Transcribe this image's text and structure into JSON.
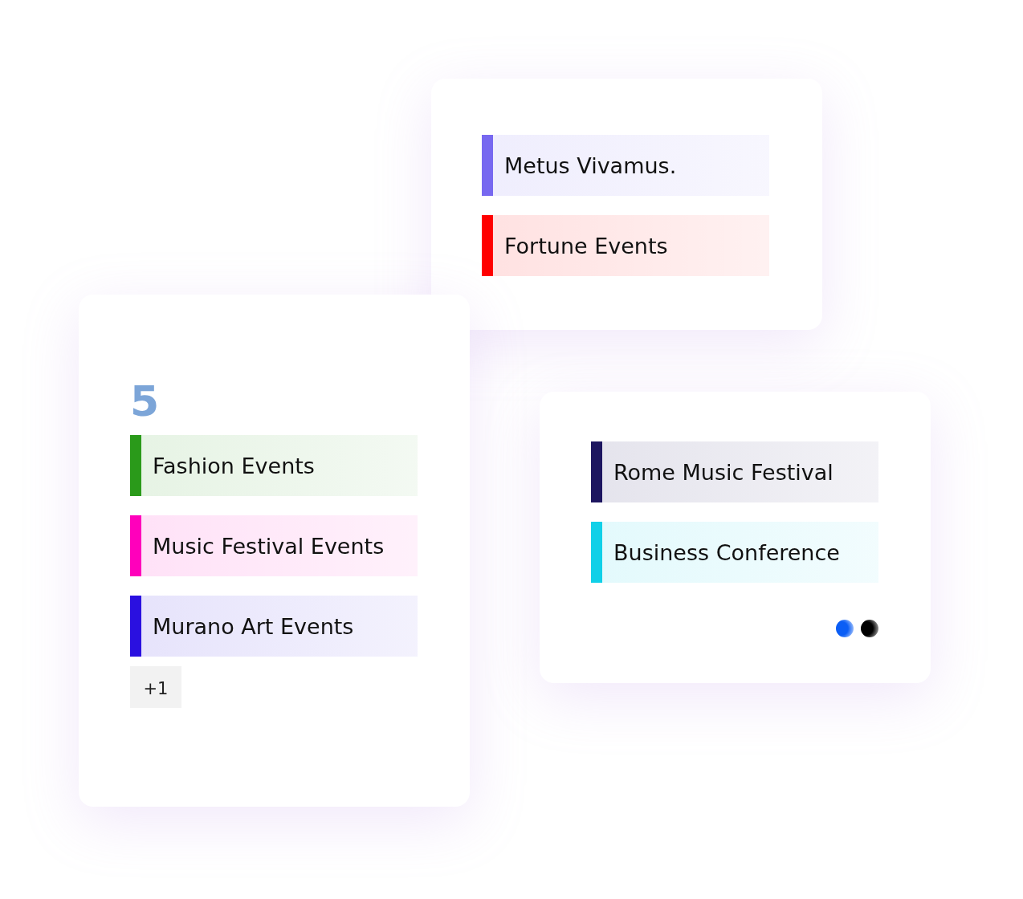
{
  "cards": [
    {
      "events": [
        {
          "title": "Metus Vivamus.",
          "color": "#7768f0"
        },
        {
          "title": "Fortune Events",
          "color": "#ff0000"
        }
      ]
    },
    {
      "day": "5",
      "events": [
        {
          "title": "Fashion Events",
          "color": "#2a9a1a"
        },
        {
          "title": "Music Festival Events",
          "color": "#ff00bb"
        },
        {
          "title": "Murano Art Events",
          "color": "#2a10e0"
        }
      ],
      "more": "+1"
    },
    {
      "events": [
        {
          "title": "Rome Music Festival",
          "color": "#1d1660"
        },
        {
          "title": "Business Conference",
          "color": "#10d0e8"
        }
      ],
      "dots": [
        {
          "color": "#0b5ef5"
        },
        {
          "color": "#000000"
        }
      ]
    }
  ]
}
